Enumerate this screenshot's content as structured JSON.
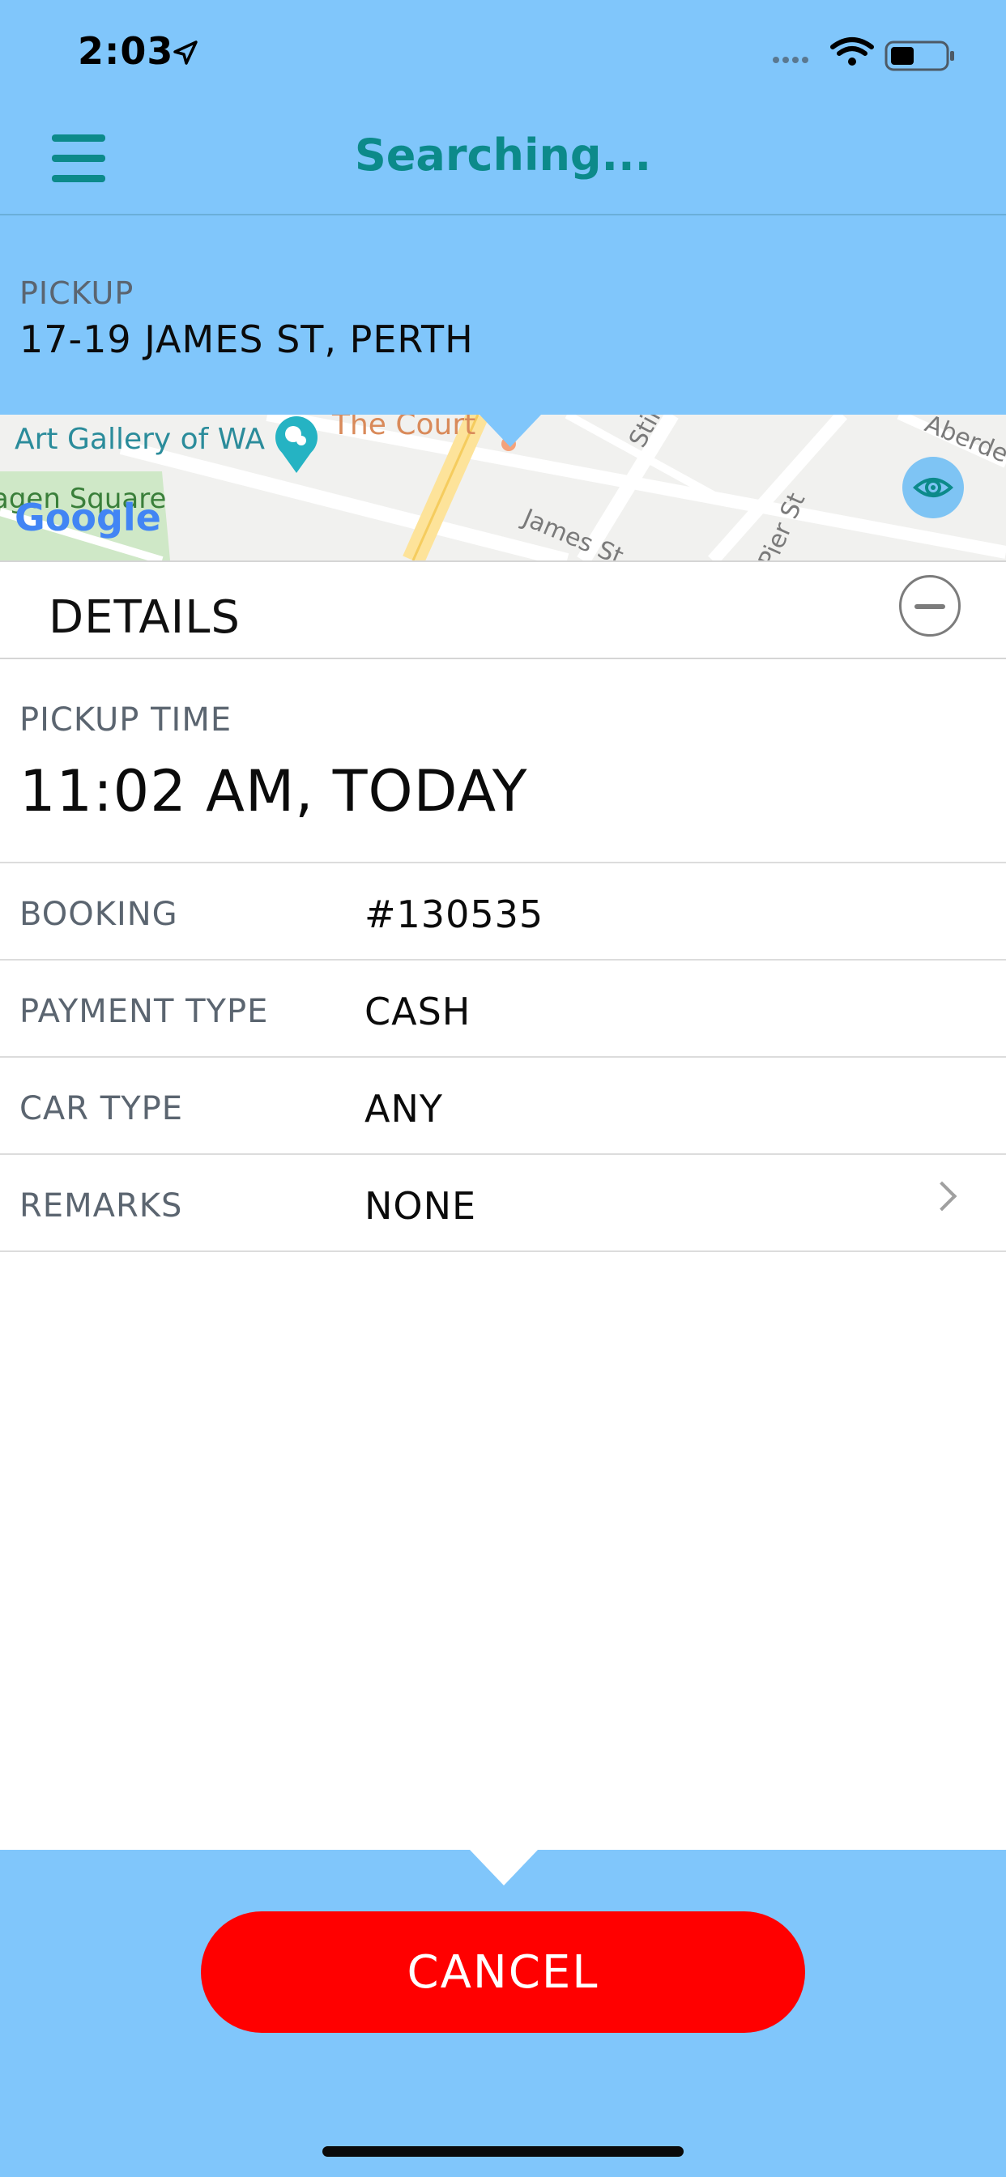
{
  "status_bar": {
    "time": "2:03"
  },
  "header": {
    "title": "Searching..."
  },
  "pickup": {
    "label": "PICKUP",
    "address": "17-19 JAMES ST, PERTH"
  },
  "map": {
    "labels": [
      "Art Gallery of WA",
      "The Court",
      "Stirling",
      "Aberdeen",
      "James St",
      "Pier St",
      "agen Square"
    ],
    "attribution": "Google"
  },
  "details": {
    "title": "DETAILS",
    "pickup_time_label": "PICKUP TIME",
    "pickup_time_value": "11:02 AM, TODAY",
    "rows": [
      {
        "label": "BOOKING",
        "value": "#130535"
      },
      {
        "label": "PAYMENT TYPE",
        "value": "CASH"
      },
      {
        "label": "CAR TYPE",
        "value": "ANY"
      },
      {
        "label": "REMARKS",
        "value": "NONE"
      }
    ]
  },
  "actions": {
    "cancel_label": "CANCEL"
  },
  "colors": {
    "header_bg": "#80C6FB",
    "title_teal": "#0C8A8A",
    "cancel_red": "#FF0000"
  }
}
